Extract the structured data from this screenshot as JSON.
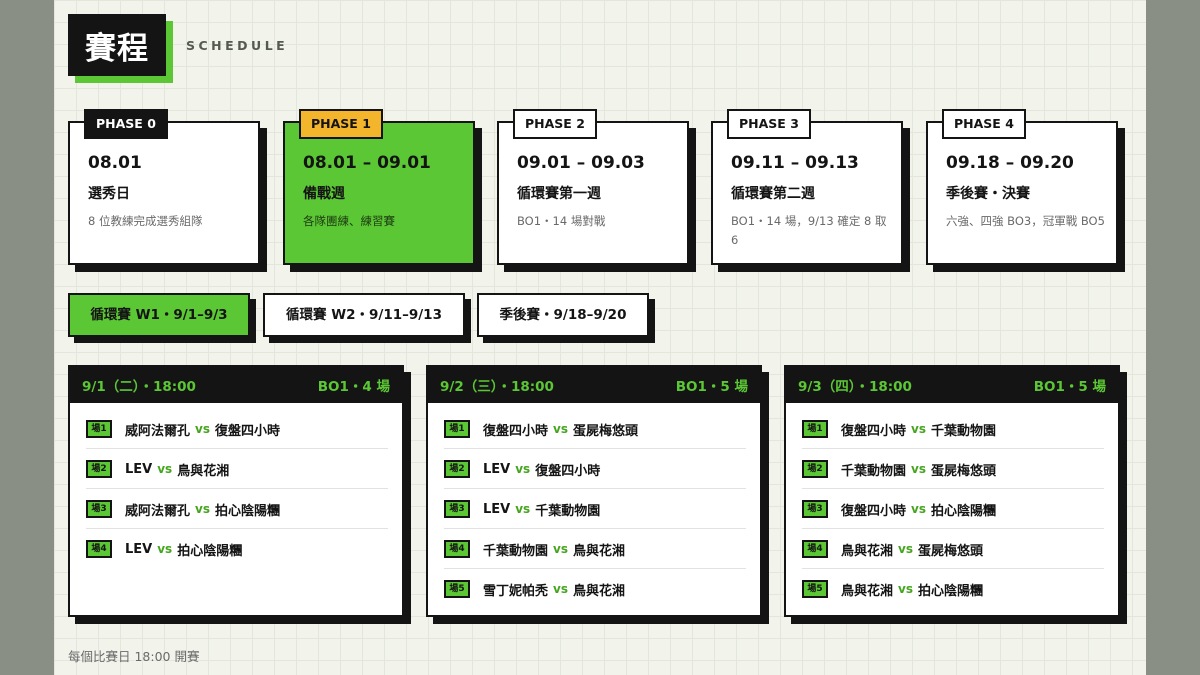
{
  "header": {
    "title": "賽程",
    "subtitle": "SCHEDULE"
  },
  "phases": [
    {
      "tag": "PHASE 0",
      "date": "08.01",
      "name": "選秀日",
      "desc": "8 位教練完成選秀組隊"
    },
    {
      "tag": "PHASE 1",
      "date": "08.01 – 09.01",
      "name": "備戰週",
      "desc": "各隊團練、練習賽"
    },
    {
      "tag": "PHASE 2",
      "date": "09.01 – 09.03",
      "name": "循環賽第一週",
      "desc": "BO1・14 場對戰"
    },
    {
      "tag": "PHASE 3",
      "date": "09.11 – 09.13",
      "name": "循環賽第二週",
      "desc": "BO1・14 場，9/13 確定 8 取 6"
    },
    {
      "tag": "PHASE 4",
      "date": "09.18 – 09.20",
      "name": "季後賽・決賽",
      "desc": "六強、四強 BO3，冠軍戰 BO5"
    }
  ],
  "tabs": [
    {
      "label": "循環賽 W1・9/1–9/3"
    },
    {
      "label": "循環賽 W2・9/11–9/13"
    },
    {
      "label": "季後賽・9/18–9/20"
    }
  ],
  "days": [
    {
      "date": "9/1（二）・18:00",
      "format": "BO1・4 場",
      "matches": [
        {
          "num": "場1",
          "home": "威阿法爾孔",
          "vs": "vs",
          "away": "復盤四小時"
        },
        {
          "num": "場2",
          "home": "LEV",
          "vs": "vs",
          "away": "鳥與花湘"
        },
        {
          "num": "場3",
          "home": "威阿法爾孔",
          "vs": "vs",
          "away": "拍心陰陽糰"
        },
        {
          "num": "場4",
          "home": "LEV",
          "vs": "vs",
          "away": "拍心陰陽糰"
        }
      ]
    },
    {
      "date": "9/2（三）・18:00",
      "format": "BO1・5 場",
      "matches": [
        {
          "num": "場1",
          "home": "復盤四小時",
          "vs": "vs",
          "away": "蛋屍梅悠頭"
        },
        {
          "num": "場2",
          "home": "LEV",
          "vs": "vs",
          "away": "復盤四小時"
        },
        {
          "num": "場3",
          "home": "LEV",
          "vs": "vs",
          "away": "千葉動物園"
        },
        {
          "num": "場4",
          "home": "千葉動物園",
          "vs": "vs",
          "away": "鳥與花湘"
        },
        {
          "num": "場5",
          "home": "雪丁妮帕秃",
          "vs": "vs",
          "away": "鳥與花湘"
        }
      ]
    },
    {
      "date": "9/3（四）・18:00",
      "format": "BO1・5 場",
      "matches": [
        {
          "num": "場1",
          "home": "復盤四小時",
          "vs": "vs",
          "away": "千葉動物園"
        },
        {
          "num": "場2",
          "home": "千葉動物園",
          "vs": "vs",
          "away": "蛋屍梅悠頭"
        },
        {
          "num": "場3",
          "home": "復盤四小時",
          "vs": "vs",
          "away": "拍心陰陽糰"
        },
        {
          "num": "場4",
          "home": "鳥與花湘",
          "vs": "vs",
          "away": "蛋屍梅悠頭"
        },
        {
          "num": "場5",
          "home": "鳥與花湘",
          "vs": "vs",
          "away": "拍心陰陽糰"
        }
      ]
    }
  ],
  "footer": {
    "note": "每個比賽日 18:00 開賽"
  },
  "colors": {
    "accent": "#5cc735",
    "dark": "#141414",
    "phase1_tag": "#f3b52c",
    "background": "#f2f4ec"
  }
}
